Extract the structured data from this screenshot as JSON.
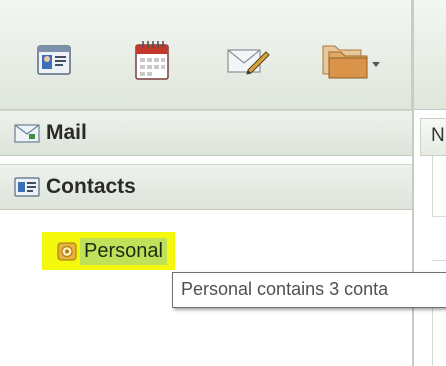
{
  "toolbar": {
    "buttons": [
      {
        "name": "contact-card-icon"
      },
      {
        "name": "calendar-icon"
      },
      {
        "name": "compose-mail-icon"
      },
      {
        "name": "folders-dropdown-icon"
      }
    ]
  },
  "nav": {
    "sections": [
      {
        "label": "Mail",
        "icon": "mail-icon"
      },
      {
        "label": "Contacts",
        "icon": "contacts-icon"
      }
    ],
    "tree": [
      {
        "label": "Personal",
        "icon": "address-book-icon",
        "highlight": "#f3f80c"
      }
    ]
  },
  "right": {
    "column_header": "N"
  },
  "tooltip": {
    "text": "Personal contains 3 conta"
  },
  "colors": {
    "toolbar_bg": "#dfe6dc",
    "highlight": "#f3f80c",
    "selection": "#bfe15a"
  }
}
